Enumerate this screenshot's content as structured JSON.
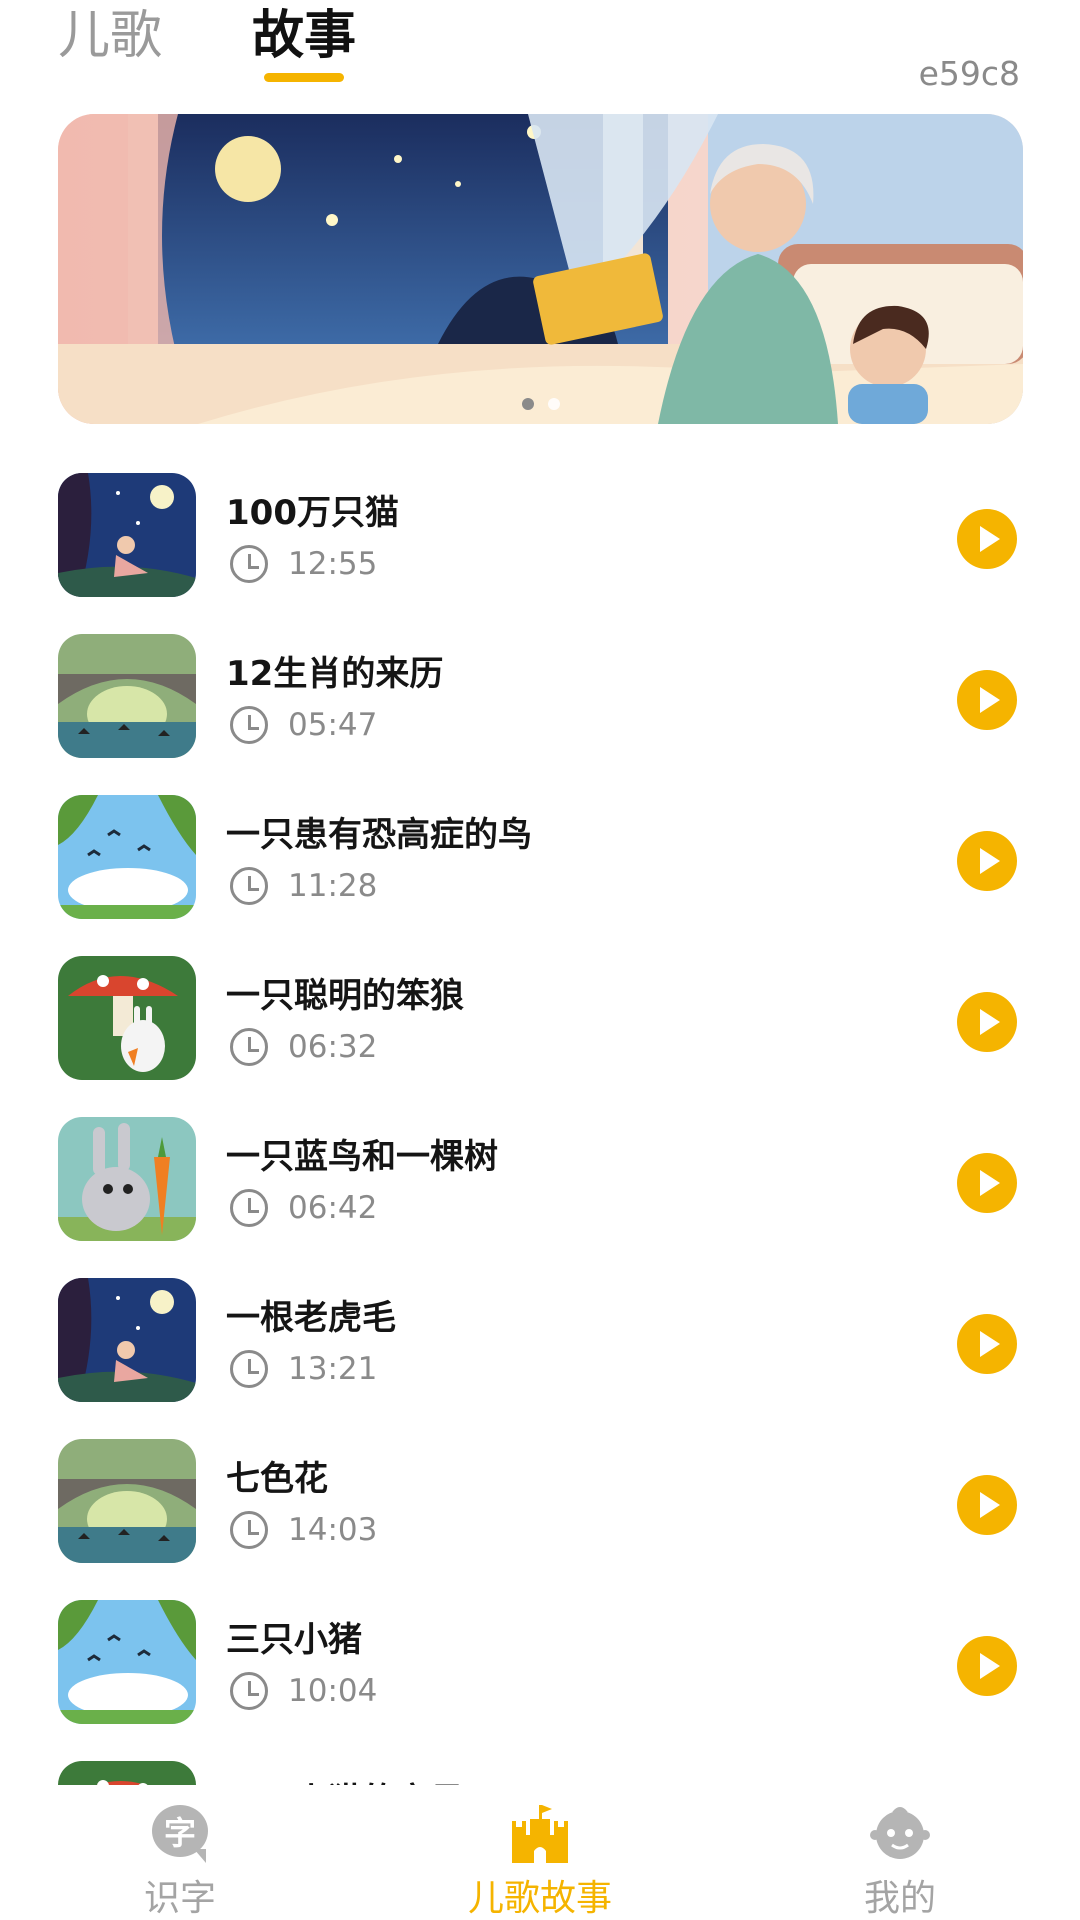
{
  "header": {
    "tabs": [
      {
        "label": "儿歌",
        "active": false
      },
      {
        "label": "故事",
        "active": true
      }
    ],
    "code": "e59c8"
  },
  "banner": {
    "slide_count": 2,
    "active_slide": 1
  },
  "stories": [
    {
      "title": "100万只猫",
      "duration": "12:55",
      "thumb": "night-girl"
    },
    {
      "title": "12生肖的来历",
      "duration": "05:47",
      "thumb": "bridge"
    },
    {
      "title": "一只患有恐高症的鸟",
      "duration": "11:28",
      "thumb": "birds-sky"
    },
    {
      "title": "一只聪明的笨狼",
      "duration": "06:32",
      "thumb": "mushroom-bunny"
    },
    {
      "title": "一只蓝鸟和一棵树",
      "duration": "06:42",
      "thumb": "rabbit-carrot"
    },
    {
      "title": "一根老虎毛",
      "duration": "13:21",
      "thumb": "night-girl"
    },
    {
      "title": "七色花",
      "duration": "14:03",
      "thumb": "bridge"
    },
    {
      "title": "三只小猪",
      "duration": "10:04",
      "thumb": "birds-sky"
    },
    {
      "title": "三只小猫的宝贝",
      "duration": "",
      "thumb": "mushroom-bunny"
    }
  ],
  "bottom_nav": [
    {
      "label": "识字",
      "icon": "zi-bubble-icon",
      "icon_text": "字",
      "active": false
    },
    {
      "label": "儿歌故事",
      "icon": "castle-icon",
      "active": true
    },
    {
      "label": "我的",
      "icon": "baby-face-icon",
      "active": false
    }
  ],
  "colors": {
    "accent": "#f5b400",
    "muted": "#8a8a8a",
    "inactive_nav": "#a4a4a4"
  }
}
